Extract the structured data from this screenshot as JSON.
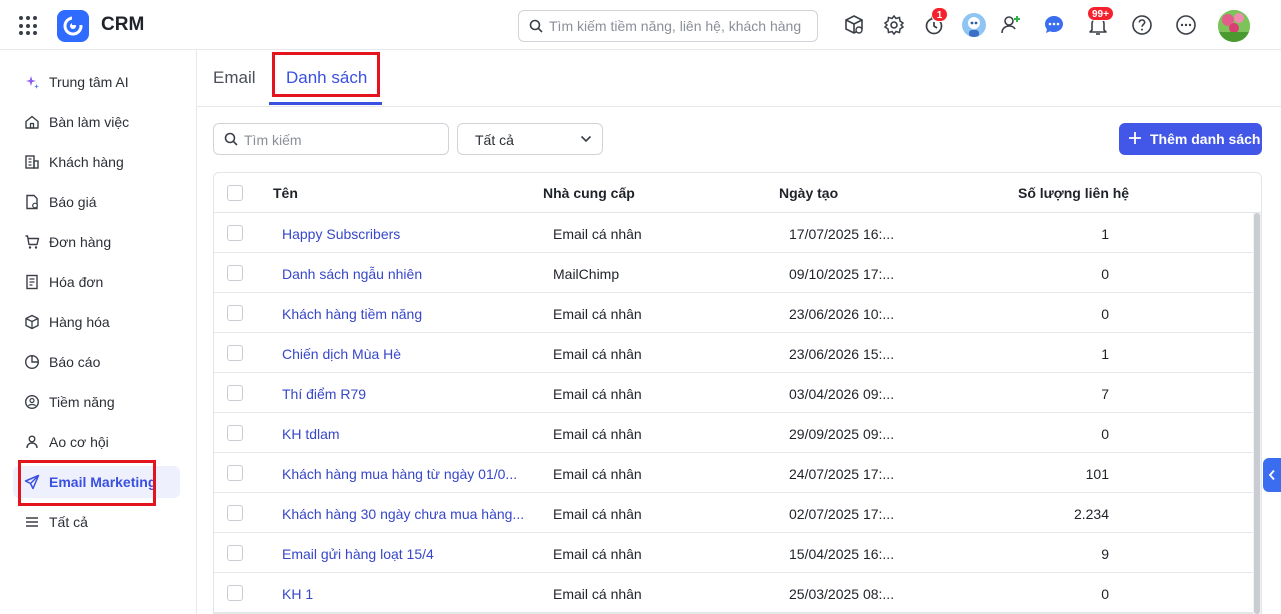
{
  "app": {
    "name": "CRM"
  },
  "header": {
    "search_placeholder": "Tìm kiếm tiềm năng, liên hệ, khách hàng",
    "reminder_badge": "1",
    "notification_badge": "99+"
  },
  "sidebar": {
    "items": [
      {
        "label": "Trung tâm AI",
        "icon": "sparkle-icon"
      },
      {
        "label": "Bàn làm việc",
        "icon": "home-icon"
      },
      {
        "label": "Khách hàng",
        "icon": "building-icon"
      },
      {
        "label": "Báo giá",
        "icon": "quote-doc-icon"
      },
      {
        "label": "Đơn hàng",
        "icon": "cart-icon"
      },
      {
        "label": "Hóa đơn",
        "icon": "invoice-icon"
      },
      {
        "label": "Hàng hóa",
        "icon": "box-icon"
      },
      {
        "label": "Báo cáo",
        "icon": "pie-chart-icon"
      },
      {
        "label": "Tiềm năng",
        "icon": "lead-icon"
      },
      {
        "label": "Ao cơ hội",
        "icon": "opportunity-icon"
      },
      {
        "label": "Email Marketing",
        "icon": "send-icon",
        "active": true
      },
      {
        "label": "Tất cả",
        "icon": "menu-icon"
      }
    ]
  },
  "tabs": [
    {
      "label": "Email"
    },
    {
      "label": "Danh sách",
      "active": true
    }
  ],
  "toolbar": {
    "search_placeholder": "Tìm kiếm",
    "filter_value": "Tất cả",
    "add_button": "Thêm danh sách"
  },
  "table": {
    "columns": [
      "Tên",
      "Nhà cung cấp",
      "Ngày tạo",
      "Số lượng liên hệ"
    ],
    "rows": [
      {
        "name": "Happy Subscribers",
        "provider": "Email cá nhân",
        "created": "17/07/2025 16:...",
        "contacts": "1"
      },
      {
        "name": "Danh sách ngẫu nhiên",
        "provider": "MailChimp",
        "created": "09/10/2025 17:...",
        "contacts": "0"
      },
      {
        "name": "Khách hàng tiềm năng",
        "provider": "Email cá nhân",
        "created": "23/06/2026 10:...",
        "contacts": "0"
      },
      {
        "name": "Chiến dịch Mùa Hè",
        "provider": "Email cá nhân",
        "created": "23/06/2026 15:...",
        "contacts": "1"
      },
      {
        "name": "Thí điểm R79",
        "provider": "Email cá nhân",
        "created": "03/04/2026 09:...",
        "contacts": "7"
      },
      {
        "name": "KH tdlam",
        "provider": "Email cá nhân",
        "created": "29/09/2025 09:...",
        "contacts": "0"
      },
      {
        "name": "Khách hàng mua hàng từ ngày 01/0...",
        "provider": "Email cá nhân",
        "created": "24/07/2025 17:...",
        "contacts": "101"
      },
      {
        "name": "Khách hàng 30 ngày chưa mua hàng...",
        "provider": "Email cá nhân",
        "created": "02/07/2025 17:...",
        "contacts": "2.234"
      },
      {
        "name": "Email gửi hàng loạt 15/4",
        "provider": "Email cá nhân",
        "created": "15/04/2025 16:...",
        "contacts": "9"
      },
      {
        "name": "KH 1",
        "provider": "Email cá nhân",
        "created": "25/03/2025 08:...",
        "contacts": "0"
      }
    ]
  },
  "colors": {
    "accent": "#3a50e0",
    "button": "#4257e8",
    "highlight_box": "#e3141e",
    "badge": "#f5222d"
  }
}
